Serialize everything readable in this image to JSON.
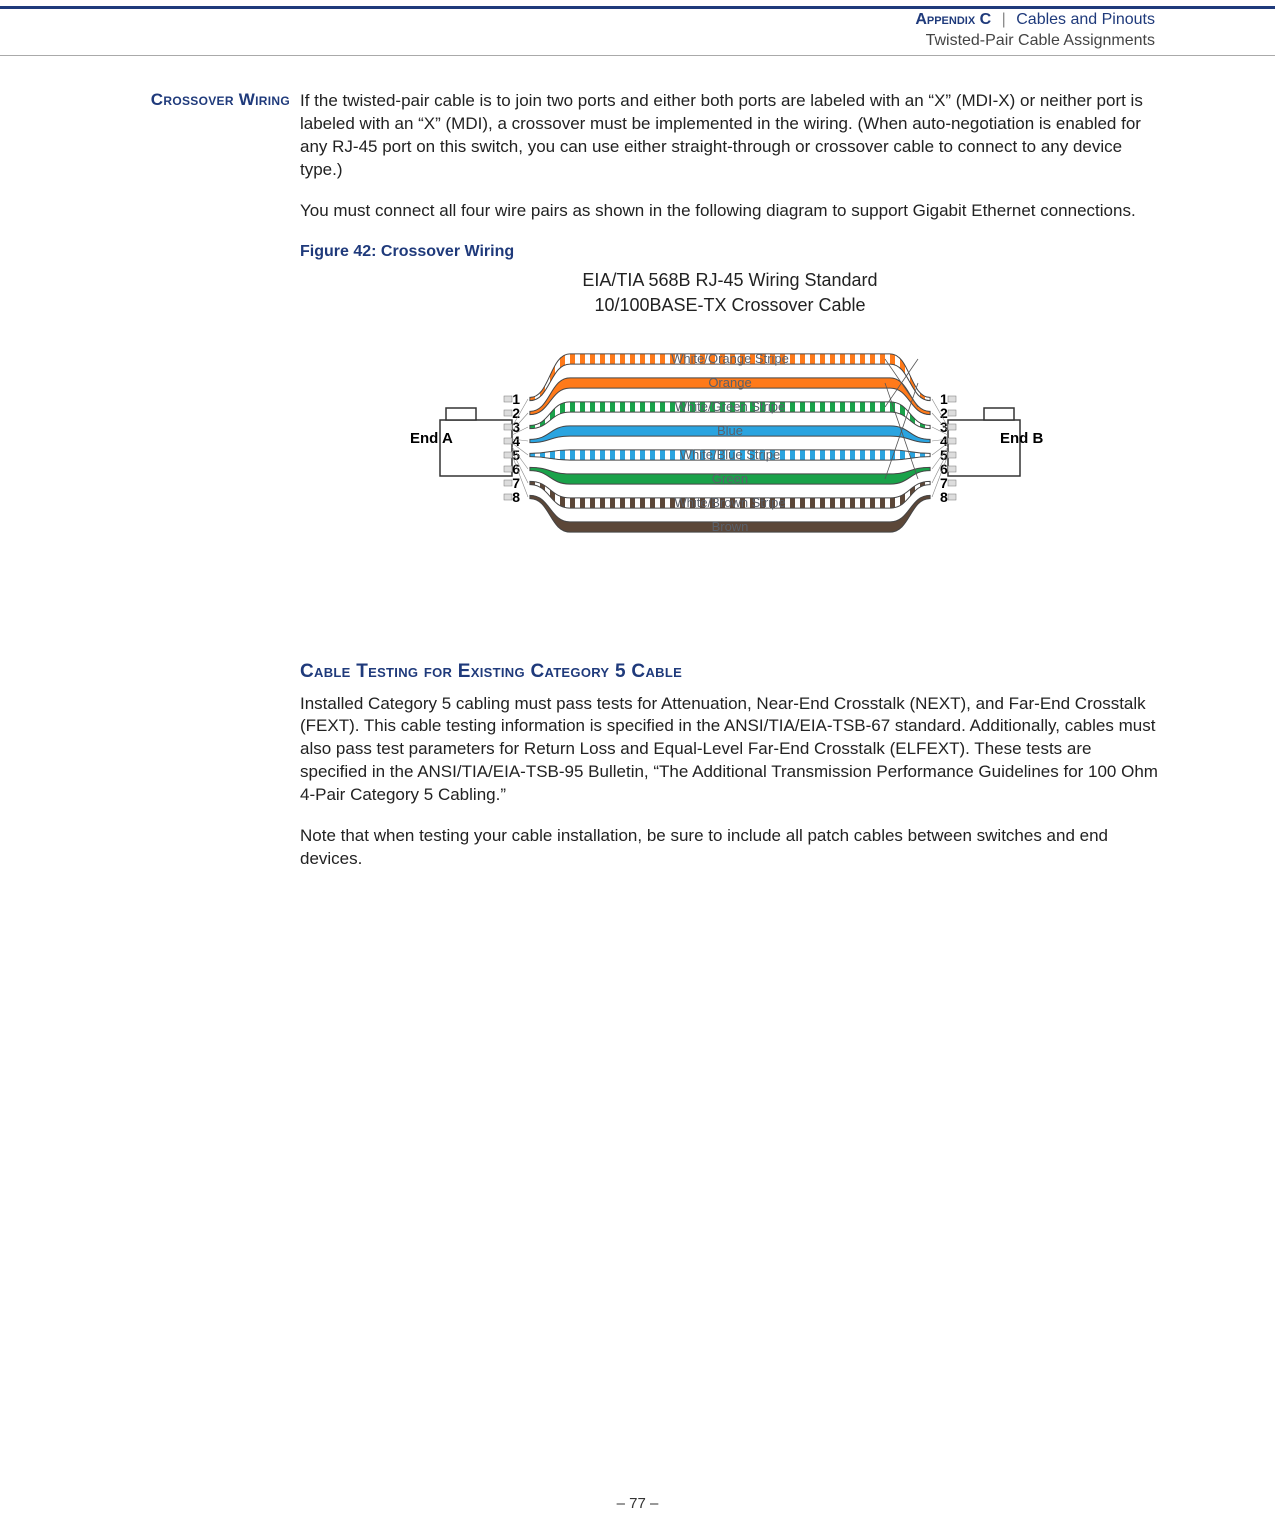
{
  "header": {
    "appendix": "Appendix C",
    "separator": "|",
    "chapter": "Cables and Pinouts",
    "subsection": "Twisted-Pair Cable Assignments"
  },
  "section1": {
    "heading": "Crossover Wiring",
    "para1": "If the twisted-pair cable is to join two ports and either both ports are labeled with an “X” (MDI-X) or neither port is labeled with an “X” (MDI), a crossover must be implemented in the wiring. (When auto-negotiation is enabled for any RJ-45 port on this switch, you can use either straight-through or crossover cable to connect to any device type.)",
    "para2": "You must connect all four wire pairs as shown in the following diagram to support Gigabit Ethernet connections."
  },
  "figure": {
    "caption": "Figure 42:  Crossover Wiring",
    "title_line1": "EIA/TIA 568B RJ-45 Wiring Standard",
    "title_line2": "10/100BASE-TX Crossover Cable",
    "end_a": "End A",
    "end_b": "End B",
    "pins_a": [
      "1",
      "2",
      "3",
      "4",
      "5",
      "6",
      "7",
      "8"
    ],
    "pins_b": [
      "1",
      "2",
      "3",
      "4",
      "5",
      "6",
      "7",
      "8"
    ],
    "wires": [
      {
        "label": "White/Orange Stripe",
        "fill": "#ffffff",
        "stripe": "#ff7a1a",
        "a": 1,
        "b": 1
      },
      {
        "label": "Orange",
        "fill": "#ff7a1a",
        "stripe": null,
        "a": 2,
        "b": 2
      },
      {
        "label": "White/Green Stripe",
        "fill": "#ffffff",
        "stripe": "#1aa24a",
        "a": 3,
        "b": 3
      },
      {
        "label": "Blue",
        "fill": "#2aa4e0",
        "stripe": null,
        "a": 4,
        "b": 4
      },
      {
        "label": "White/Blue Stripe",
        "fill": "#ffffff",
        "stripe": "#2aa4e0",
        "a": 5,
        "b": 5
      },
      {
        "label": "Green",
        "fill": "#1aa24a",
        "stripe": null,
        "a": 6,
        "b": 6
      },
      {
        "label": "White/Brown Stripe",
        "fill": "#ffffff",
        "stripe": "#5c4738",
        "a": 7,
        "b": 7
      },
      {
        "label": "Brown",
        "fill": "#5c4738",
        "stripe": null,
        "a": 8,
        "b": 8
      }
    ],
    "crossovers": [
      {
        "a": 1,
        "b": 3
      },
      {
        "a": 2,
        "b": 6
      },
      {
        "a": 3,
        "b": 1
      },
      {
        "a": 6,
        "b": 2
      }
    ]
  },
  "section2": {
    "heading": "Cable Testing for Existing Category 5 Cable",
    "para1": "Installed Category 5 cabling must pass tests for Attenuation, Near-End Crosstalk (NEXT), and Far-End Crosstalk (FEXT). This cable testing information is specified in the ANSI/TIA/EIA-TSB-67 standard. Additionally, cables must also pass test parameters for Return Loss and Equal-Level Far-End Crosstalk (ELFEXT). These tests are specified in the ANSI/TIA/EIA-TSB-95 Bulletin, “The Additional Transmission Performance Guidelines for 100 Ohm 4-Pair Category 5 Cabling.”",
    "para2": "Note that when testing your cable installation, be sure to include all patch cables between switches and end devices."
  },
  "footer": {
    "page": "–  77  –"
  }
}
